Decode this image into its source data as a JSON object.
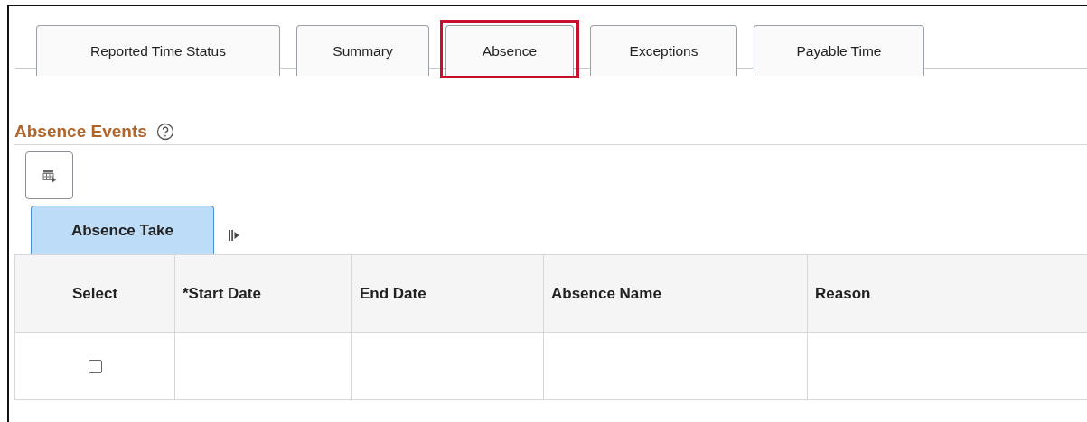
{
  "tabs": [
    {
      "label": "Reported Time Status",
      "highlighted": false
    },
    {
      "label": "Summary",
      "highlighted": false
    },
    {
      "label": "Absence",
      "highlighted": true
    },
    {
      "label": "Exceptions",
      "highlighted": false
    },
    {
      "label": "Payable Time",
      "highlighted": false
    }
  ],
  "section": {
    "title": "Absence Events"
  },
  "grid_tabs": [
    {
      "label": "Absence Take",
      "selected": true
    }
  ],
  "table": {
    "columns": [
      "Select",
      "*Start Date",
      "End Date",
      "Absence Name",
      "Reason"
    ],
    "rows": [
      {
        "checked": false
      }
    ]
  }
}
